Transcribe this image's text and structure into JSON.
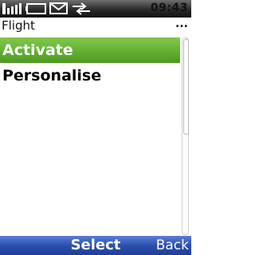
{
  "status": {
    "time": "09:43",
    "icons": [
      "signal-icon",
      "battery-icon",
      "message-icon",
      "data-transfer-icon"
    ]
  },
  "header": {
    "title": "Flight",
    "more": "..."
  },
  "menu": {
    "items": [
      {
        "label": "Activate",
        "selected": true
      },
      {
        "label": "Personalise",
        "selected": false
      }
    ]
  },
  "softkeys": {
    "center": "Select",
    "right": "Back"
  },
  "colors": {
    "selection": "#5fae2f",
    "softkey_bar": "#2c4fae"
  }
}
